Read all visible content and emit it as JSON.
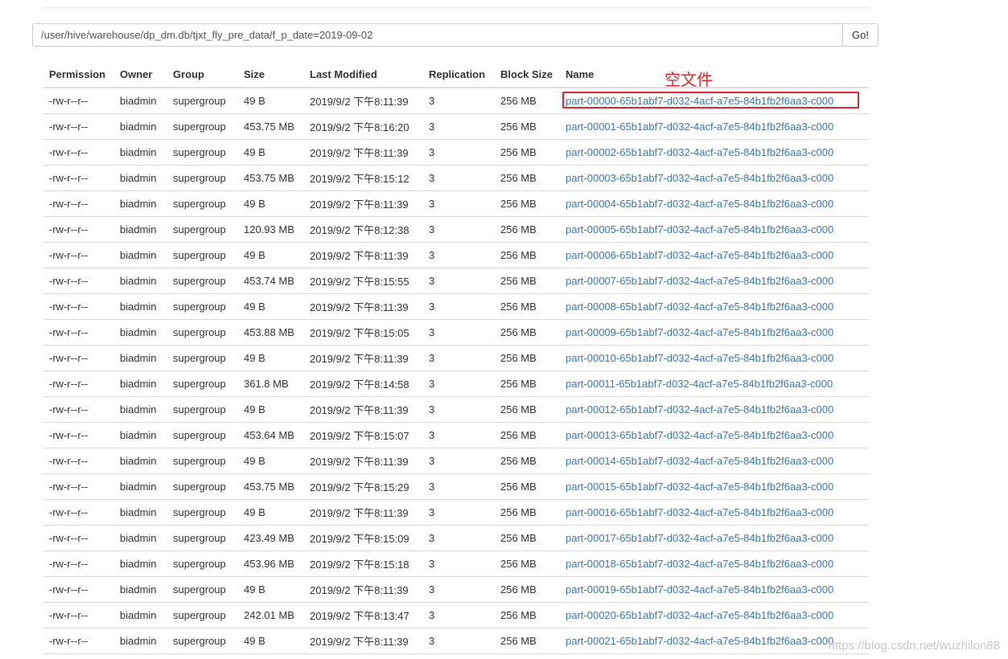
{
  "path_bar": {
    "path_value": "/user/hive/warehouse/dp_dm.db/tjxt_fly_pre_data/f_p_date=2019-09-02",
    "go_label": "Go!"
  },
  "table": {
    "headers": [
      "Permission",
      "Owner",
      "Group",
      "Size",
      "Last Modified",
      "Replication",
      "Block Size",
      "Name"
    ],
    "rows": [
      [
        "-rw-r--r--",
        "biadmin",
        "supergroup",
        "49 B",
        "2019/9/2 下午8:11:39",
        "3",
        "256 MB",
        "part-00000-65b1abf7-d032-4acf-a7e5-84b1fb2f6aa3-c000"
      ],
      [
        "-rw-r--r--",
        "biadmin",
        "supergroup",
        "453.75 MB",
        "2019/9/2 下午8:16:20",
        "3",
        "256 MB",
        "part-00001-65b1abf7-d032-4acf-a7e5-84b1fb2f6aa3-c000"
      ],
      [
        "-rw-r--r--",
        "biadmin",
        "supergroup",
        "49 B",
        "2019/9/2 下午8:11:39",
        "3",
        "256 MB",
        "part-00002-65b1abf7-d032-4acf-a7e5-84b1fb2f6aa3-c000"
      ],
      [
        "-rw-r--r--",
        "biadmin",
        "supergroup",
        "453.75 MB",
        "2019/9/2 下午8:15:12",
        "3",
        "256 MB",
        "part-00003-65b1abf7-d032-4acf-a7e5-84b1fb2f6aa3-c000"
      ],
      [
        "-rw-r--r--",
        "biadmin",
        "supergroup",
        "49 B",
        "2019/9/2 下午8:11:39",
        "3",
        "256 MB",
        "part-00004-65b1abf7-d032-4acf-a7e5-84b1fb2f6aa3-c000"
      ],
      [
        "-rw-r--r--",
        "biadmin",
        "supergroup",
        "120.93 MB",
        "2019/9/2 下午8:12:38",
        "3",
        "256 MB",
        "part-00005-65b1abf7-d032-4acf-a7e5-84b1fb2f6aa3-c000"
      ],
      [
        "-rw-r--r--",
        "biadmin",
        "supergroup",
        "49 B",
        "2019/9/2 下午8:11:39",
        "3",
        "256 MB",
        "part-00006-65b1abf7-d032-4acf-a7e5-84b1fb2f6aa3-c000"
      ],
      [
        "-rw-r--r--",
        "biadmin",
        "supergroup",
        "453.74 MB",
        "2019/9/2 下午8:15:55",
        "3",
        "256 MB",
        "part-00007-65b1abf7-d032-4acf-a7e5-84b1fb2f6aa3-c000"
      ],
      [
        "-rw-r--r--",
        "biadmin",
        "supergroup",
        "49 B",
        "2019/9/2 下午8:11:39",
        "3",
        "256 MB",
        "part-00008-65b1abf7-d032-4acf-a7e5-84b1fb2f6aa3-c000"
      ],
      [
        "-rw-r--r--",
        "biadmin",
        "supergroup",
        "453.88 MB",
        "2019/9/2 下午8:15:05",
        "3",
        "256 MB",
        "part-00009-65b1abf7-d032-4acf-a7e5-84b1fb2f6aa3-c000"
      ],
      [
        "-rw-r--r--",
        "biadmin",
        "supergroup",
        "49 B",
        "2019/9/2 下午8:11:39",
        "3",
        "256 MB",
        "part-00010-65b1abf7-d032-4acf-a7e5-84b1fb2f6aa3-c000"
      ],
      [
        "-rw-r--r--",
        "biadmin",
        "supergroup",
        "361.8 MB",
        "2019/9/2 下午8:14:58",
        "3",
        "256 MB",
        "part-00011-65b1abf7-d032-4acf-a7e5-84b1fb2f6aa3-c000"
      ],
      [
        "-rw-r--r--",
        "biadmin",
        "supergroup",
        "49 B",
        "2019/9/2 下午8:11:39",
        "3",
        "256 MB",
        "part-00012-65b1abf7-d032-4acf-a7e5-84b1fb2f6aa3-c000"
      ],
      [
        "-rw-r--r--",
        "biadmin",
        "supergroup",
        "453.64 MB",
        "2019/9/2 下午8:15:07",
        "3",
        "256 MB",
        "part-00013-65b1abf7-d032-4acf-a7e5-84b1fb2f6aa3-c000"
      ],
      [
        "-rw-r--r--",
        "biadmin",
        "supergroup",
        "49 B",
        "2019/9/2 下午8:11:39",
        "3",
        "256 MB",
        "part-00014-65b1abf7-d032-4acf-a7e5-84b1fb2f6aa3-c000"
      ],
      [
        "-rw-r--r--",
        "biadmin",
        "supergroup",
        "453.75 MB",
        "2019/9/2 下午8:15:29",
        "3",
        "256 MB",
        "part-00015-65b1abf7-d032-4acf-a7e5-84b1fb2f6aa3-c000"
      ],
      [
        "-rw-r--r--",
        "biadmin",
        "supergroup",
        "49 B",
        "2019/9/2 下午8:11:39",
        "3",
        "256 MB",
        "part-00016-65b1abf7-d032-4acf-a7e5-84b1fb2f6aa3-c000"
      ],
      [
        "-rw-r--r--",
        "biadmin",
        "supergroup",
        "423.49 MB",
        "2019/9/2 下午8:15:09",
        "3",
        "256 MB",
        "part-00017-65b1abf7-d032-4acf-a7e5-84b1fb2f6aa3-c000"
      ],
      [
        "-rw-r--r--",
        "biadmin",
        "supergroup",
        "453.96 MB",
        "2019/9/2 下午8:15:18",
        "3",
        "256 MB",
        "part-00018-65b1abf7-d032-4acf-a7e5-84b1fb2f6aa3-c000"
      ],
      [
        "-rw-r--r--",
        "biadmin",
        "supergroup",
        "49 B",
        "2019/9/2 下午8:11:39",
        "3",
        "256 MB",
        "part-00019-65b1abf7-d032-4acf-a7e5-84b1fb2f6aa3-c000"
      ],
      [
        "-rw-r--r--",
        "biadmin",
        "supergroup",
        "242.01 MB",
        "2019/9/2 下午8:13:47",
        "3",
        "256 MB",
        "part-00020-65b1abf7-d032-4acf-a7e5-84b1fb2f6aa3-c000"
      ],
      [
        "-rw-r--r--",
        "biadmin",
        "supergroup",
        "49 B",
        "2019/9/2 下午8:11:39",
        "3",
        "256 MB",
        "part-00021-65b1abf7-d032-4acf-a7e5-84b1fb2f6aa3-c000"
      ]
    ]
  },
  "annotation": {
    "label": "空文件",
    "color": "#e8262a"
  },
  "colors": {
    "link": "#337ab7",
    "border": "#dddddd"
  },
  "watermark": "https://blog.csdn.net/wuzhilon88"
}
